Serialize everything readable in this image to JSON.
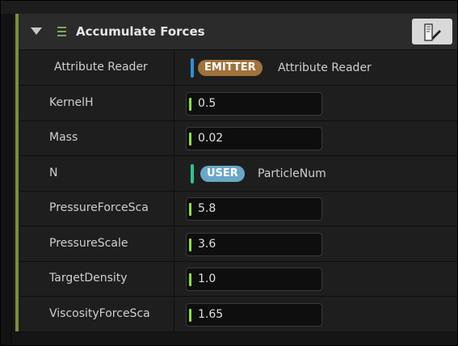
{
  "module": {
    "title": "Accumulate Forces",
    "collapse_icon": "triangle-down-icon",
    "stack_icon": "hamburger-icon",
    "doc_button_icon": "document-edit-icon",
    "accent_color": "#7a8f3a"
  },
  "rows": [
    {
      "label": "Attribute Reader",
      "type": "link",
      "badge": "EMITTER",
      "badge_color": "#a0723c",
      "pin_color": "#2f8fd8",
      "value": "Attribute Reader"
    },
    {
      "label": "KernelH",
      "type": "float",
      "value": "0.5"
    },
    {
      "label": "Mass",
      "type": "float",
      "value": "0.02"
    },
    {
      "label": "N",
      "type": "link",
      "badge": "USER",
      "badge_color": "#6aa7c7",
      "pin_color": "#2ec19a",
      "value": "ParticleNum"
    },
    {
      "label": "PressureForceSca",
      "type": "float",
      "value": "5.8"
    },
    {
      "label": "PressureScale",
      "type": "float",
      "value": "3.6"
    },
    {
      "label": "TargetDensity",
      "type": "float",
      "value": "1.0"
    },
    {
      "label": "ViscosityForceSca",
      "type": "float",
      "value": "1.65"
    }
  ]
}
